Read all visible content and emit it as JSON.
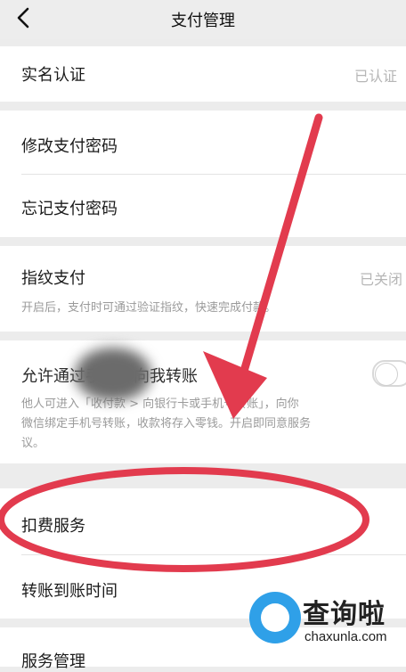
{
  "header": {
    "title": "支付管理",
    "back_icon": "chevron-left-icon"
  },
  "rows": {
    "real_name": {
      "label": "实名认证",
      "value": "已认证"
    },
    "change_password": {
      "label": "修改支付密码"
    },
    "forgot_password": {
      "label": "忘记支付密码"
    },
    "fingerprint": {
      "label": "指纹支付",
      "value": "已关闭",
      "desc": "开启后，支付时可通过验证指纹，快速完成付款。"
    },
    "allow_transfer": {
      "label": "允许通过手机号向我转账",
      "desc_line1": "他人可进入「收付款 > 向银行卡或手机号转账」，向你",
      "desc_line2": "微信绑定手机号转账，收款将存入零钱。开启即同意服务",
      "desc_line3": "议。",
      "toggle_on": false
    },
    "deduction": {
      "label": "扣费服务"
    },
    "transfer_time": {
      "label": "转账到账时间"
    },
    "service_manage": {
      "label": "服务管理"
    }
  },
  "annotation": {
    "arrow_color": "#e23b4e",
    "ellipse_color": "#e23b4e"
  },
  "watermark": {
    "brand": "查询啦",
    "domain": "chaxunla.com",
    "badge_color": "#2fa0e8"
  }
}
